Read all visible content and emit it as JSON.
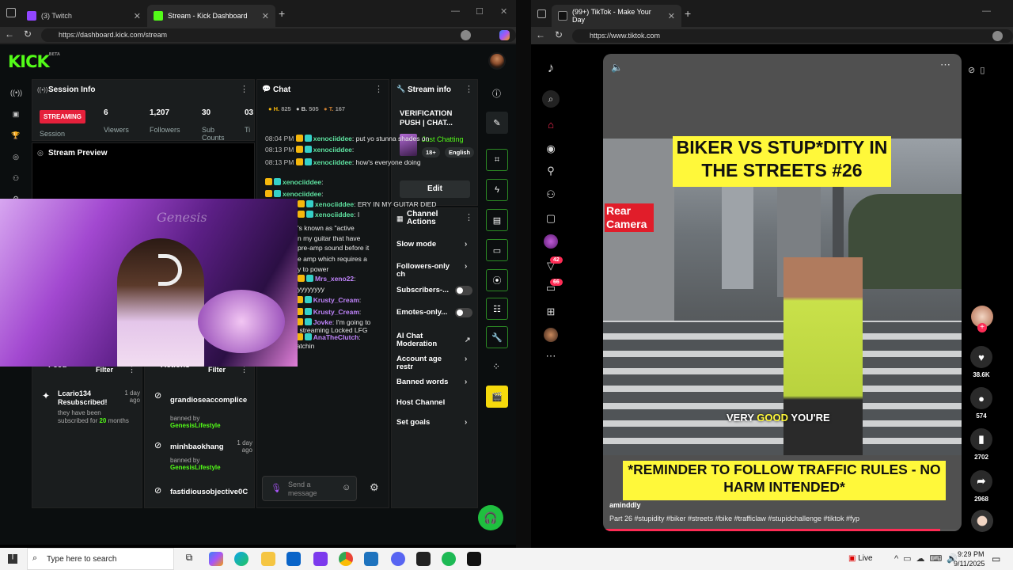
{
  "left_browser": {
    "tabs": [
      {
        "label": "(3) Twitch",
        "color": "#9146ff"
      },
      {
        "label": "Stream - Kick Dashboard",
        "color": "#53fc18"
      }
    ],
    "url": "https://dashboard.kick.com/stream"
  },
  "kick": {
    "logo": "KICK",
    "logo_tag": "BETA",
    "session": {
      "title": "Session Info",
      "badge": "STREAMING",
      "badge_label": "Session",
      "stats": [
        {
          "value": "6",
          "label": "Viewers"
        },
        {
          "value": "1,207",
          "label": "Followers"
        },
        {
          "value": "30",
          "label": "Sub Counts"
        },
        {
          "value": "03",
          "label": "Ti"
        }
      ]
    },
    "preview": {
      "title": "Stream Preview",
      "watermark": "Genesis"
    },
    "activity": {
      "title": "Activity Feed",
      "filter": "Filter",
      "item_name": "Lcario134 Resubscribed!",
      "item_time": "1 day ago",
      "item_detail_pre": "they have been subscribed for ",
      "item_detail_num": "20",
      "item_detail_post": " months"
    },
    "mod": {
      "title": "Mod Actions",
      "filter": "Filter",
      "banned_by": "banned by",
      "items": [
        {
          "name": "grandioseaccomplice",
          "by": "GenesisLifestyle",
          "time": ""
        },
        {
          "name": "minhbaokhang",
          "by": "GenesisLifestyle",
          "time": "1 day ago"
        },
        {
          "name": "fastidiousobjective0C",
          "by": "",
          "time": ""
        }
      ]
    },
    "chat": {
      "title": "Chat",
      "leaders": [
        {
          "rank": "H.",
          "value": "825"
        },
        {
          "rank": "B.",
          "value": "505"
        },
        {
          "rank": "T.",
          "value": "167"
        }
      ],
      "messages": [
        {
          "time": "08:04 PM",
          "user": "xenociiddee",
          "text": "put yo stunna shades on",
          "color": "#5ee2a0"
        },
        {
          "time": "08:13 PM",
          "user": "xenociiddee",
          "text": "",
          "color": "#5ee2a0"
        },
        {
          "time": "08:13 PM",
          "user": "xenociiddee",
          "text": "how's everyone doing",
          "color": "#5ee2a0"
        },
        {
          "time": "",
          "user": "xenociiddee",
          "text": "",
          "color": "#5ee2a0"
        },
        {
          "time": "",
          "user": "xenociiddee",
          "text": "",
          "color": "#5ee2a0"
        },
        {
          "time": "",
          "user": "xenociiddee",
          "text": "ERY IN MY GUITAR DIED",
          "color": "#5ee2a0"
        },
        {
          "time": "",
          "user": "xenociiddee",
          "text": "I",
          "color": "#5ee2a0"
        },
        {
          "time": "",
          "user": "",
          "text": "'s known as \"active",
          "color": ""
        },
        {
          "time": "",
          "user": "",
          "text": "n my guitar that have",
          "color": ""
        },
        {
          "time": "",
          "user": "",
          "text": "pre-amp sound before it",
          "color": ""
        },
        {
          "time": "",
          "user": "",
          "text": "e amp which requires a",
          "color": ""
        },
        {
          "time": "",
          "user": "",
          "text": "y to power",
          "color": ""
        },
        {
          "time": "",
          "user": "Mrs_xeno22",
          "text": "",
          "color": "#c084fc"
        },
        {
          "time": "",
          "user": "",
          "text": "yyyyyyyy",
          "color": ""
        },
        {
          "time": "08:49 PM",
          "user": "Krusty_Cream",
          "text": "",
          "color": "#c084fc"
        },
        {
          "time": "08:49 PM",
          "user": "Krusty_Cream",
          "text": "",
          "color": "#c084fc"
        },
        {
          "time": "09:05 PM",
          "user": "Jovke",
          "text": "I'm going to",
          "color": "#c084fc"
        },
        {
          "time": "",
          "user": "",
          "text": "sleep keep streaming Locked LFG",
          "color": ""
        },
        {
          "time": "09:19 PM",
          "user": "AnaTheClutch",
          "text": "",
          "color": "#c084fc"
        },
        {
          "time": "",
          "user": "",
          "text": "what we watchin",
          "color": ""
        }
      ],
      "input_placeholder": "Send a message"
    },
    "stream_info": {
      "title": "Stream info",
      "stream_title": "VERIFICATION PUSH | CHAT...",
      "category": "Just Chatting",
      "tags": [
        "18+",
        "English"
      ],
      "edit_label": "Edit"
    },
    "channel_actions": {
      "title": "Channel Actions",
      "items": [
        {
          "label": "Slow mode",
          "control": "chevron"
        },
        {
          "label": "Followers-only ch",
          "control": "chevron"
        },
        {
          "label": "Subscribers-...",
          "control": "toggle"
        },
        {
          "label": "Emotes-only...",
          "control": "toggle"
        },
        {
          "label": "AI Chat Moderation",
          "control": "external"
        },
        {
          "label": "Account age restr",
          "control": "chevron"
        },
        {
          "label": "Banned words",
          "control": "chevron"
        },
        {
          "label": "Host Channel",
          "control": "none"
        },
        {
          "label": "Set goals",
          "control": "chevron"
        }
      ]
    },
    "accent": "#53fc18"
  },
  "right_browser": {
    "tab": {
      "label": "(99+) TikTok - Make Your Day",
      "color": "#ffffff"
    },
    "url": "https://www.tiktok.com"
  },
  "tiktok": {
    "video_title": "BIKER VS STUP*DITY IN THE STREETS #26",
    "rear_camera": "Rear Camera",
    "subtitle_pre": "VERY ",
    "subtitle_hl": "GOOD",
    "subtitle_post": " YOU'RE",
    "reminder": "*REMINDER TO FOLLOW TRAFFIC RULES - NO HARM INTENDED*",
    "author": "aminddly",
    "caption": "Part 26 #stupidity #biker #streets #bike #trafficlaw #stupidchallenge #tiktok #fyp",
    "actions": [
      {
        "icon": "heart-icon",
        "count": "38.6K"
      },
      {
        "icon": "comment-icon",
        "count": "574"
      },
      {
        "icon": "bookmark-icon",
        "count": "2702"
      },
      {
        "icon": "share-icon",
        "count": "2968"
      }
    ],
    "badges": {
      "inbox": "42",
      "messages": "66"
    }
  },
  "taskbar": {
    "search_placeholder": "Type here to search",
    "live": "Live",
    "time": "9:29 PM",
    "date": "9/11/2025"
  }
}
